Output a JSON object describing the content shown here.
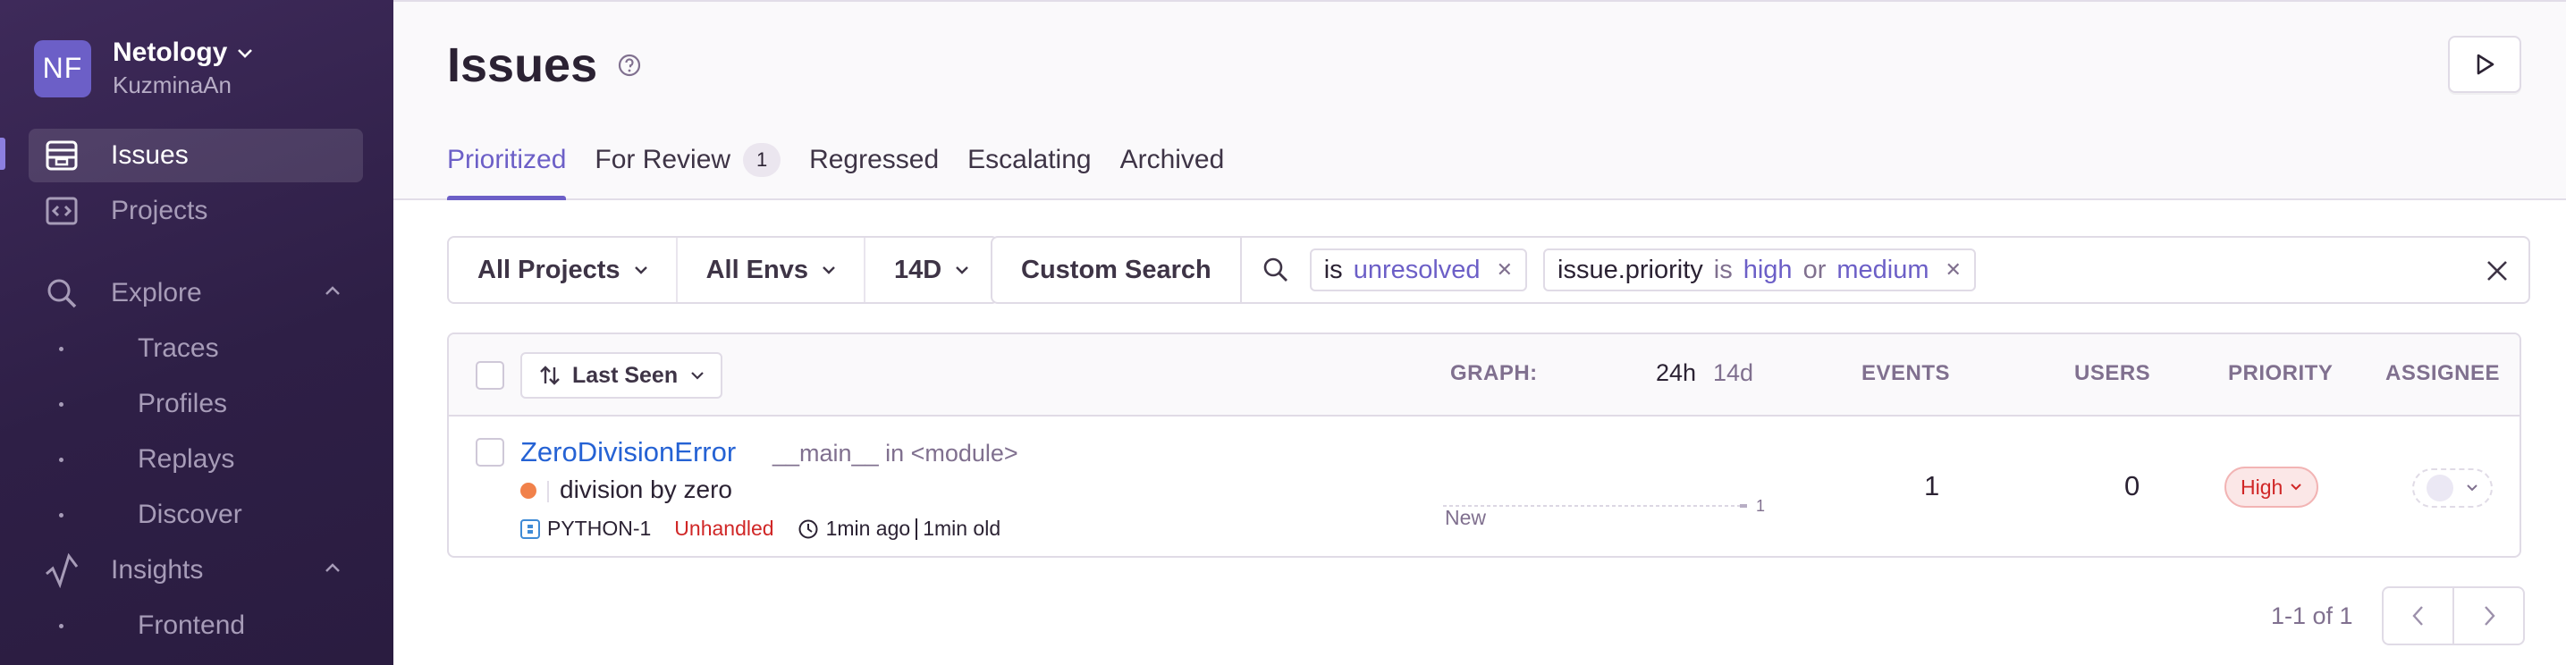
{
  "org": {
    "avatar": "NF",
    "name": "Netology",
    "user": "KuzminaAn"
  },
  "sidebar": {
    "items": [
      {
        "label": "Issues",
        "icon": "issues-icon",
        "active": true
      },
      {
        "label": "Projects",
        "icon": "projects-icon"
      },
      {
        "label": "Explore",
        "icon": "search-icon"
      },
      {
        "label": "Traces"
      },
      {
        "label": "Profiles"
      },
      {
        "label": "Replays"
      },
      {
        "label": "Discover"
      },
      {
        "label": "Insights",
        "icon": "insights-icon"
      },
      {
        "label": "Frontend"
      }
    ]
  },
  "page": {
    "title": "Issues"
  },
  "tabs": [
    {
      "label": "Prioritized",
      "active": true
    },
    {
      "label": "For Review",
      "badge": "1"
    },
    {
      "label": "Regressed"
    },
    {
      "label": "Escalating"
    },
    {
      "label": "Archived"
    }
  ],
  "filters": {
    "project": "All Projects",
    "env": "All Envs",
    "period": "14D"
  },
  "search": {
    "custom_label": "Custom Search",
    "tokens": [
      {
        "key": "is",
        "value": "unresolved"
      },
      {
        "key": "issue.priority",
        "op": "is",
        "value1": "high",
        "or": "or",
        "value2": "medium"
      }
    ]
  },
  "table": {
    "sort_label": "Last Seen",
    "headers": {
      "graph": "GRAPH:",
      "h24": "24h",
      "d14": "14d",
      "events": "EVENTS",
      "users": "USERS",
      "priority": "PRIORITY",
      "assignee": "ASSIGNEE"
    },
    "rows": [
      {
        "title": "ZeroDivisionError",
        "culprit": "__main__ in <module>",
        "message": "division by zero",
        "short_id": "PYTHON-1",
        "handled": "Unhandled",
        "times": [
          "1min ago",
          "1min old"
        ],
        "graph_max": "1",
        "graph_label": "New",
        "events": "1",
        "users": "0",
        "priority": "High"
      }
    ]
  },
  "pagination": {
    "caption": "1-1 of 1"
  },
  "colors": {
    "accent": "#6c5fc7",
    "link": "#2562d4",
    "danger": "#d02626",
    "warning_dot": "#f1814a"
  }
}
